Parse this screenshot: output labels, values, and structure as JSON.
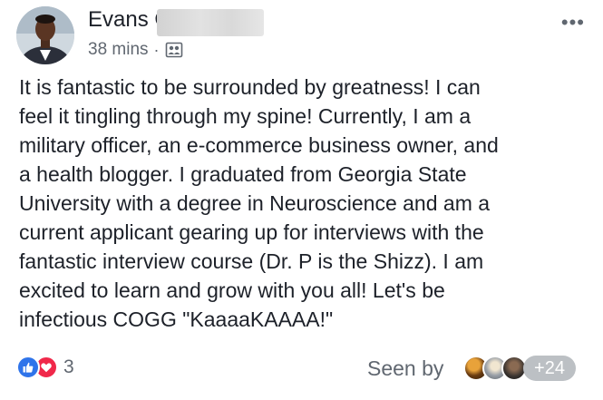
{
  "post": {
    "author_name": "Evans O",
    "time": "38 mins",
    "separator": "·",
    "audience_icon": "group-audience-icon",
    "more_icon": "more-options-icon",
    "more_label": "•••",
    "text_lines": [
      "It is fantastic to be surrounded by greatness! I can",
      "feel it tingling through my spine! Currently, I am a",
      "military officer, an e-commerce business owner, and",
      "a health blogger. I graduated from Georgia State",
      "University with a degree in Neuroscience and am a",
      "current applicant gearing up for interviews with the",
      "fantastic interview course (Dr. P is the Shizz). I am",
      "excited to learn and grow with you all! Let's be",
      "infectious COGG \"KaaaaKAAAA!\""
    ]
  },
  "footer": {
    "reaction_icons": [
      "like-icon",
      "love-icon"
    ],
    "reaction_count": "3",
    "seen_by_label": "Seen by",
    "seen_extra_count": "+24"
  },
  "colors": {
    "like": "#2f74ea",
    "love": "#f0284a",
    "text": "#1d2129",
    "meta": "#606770"
  }
}
